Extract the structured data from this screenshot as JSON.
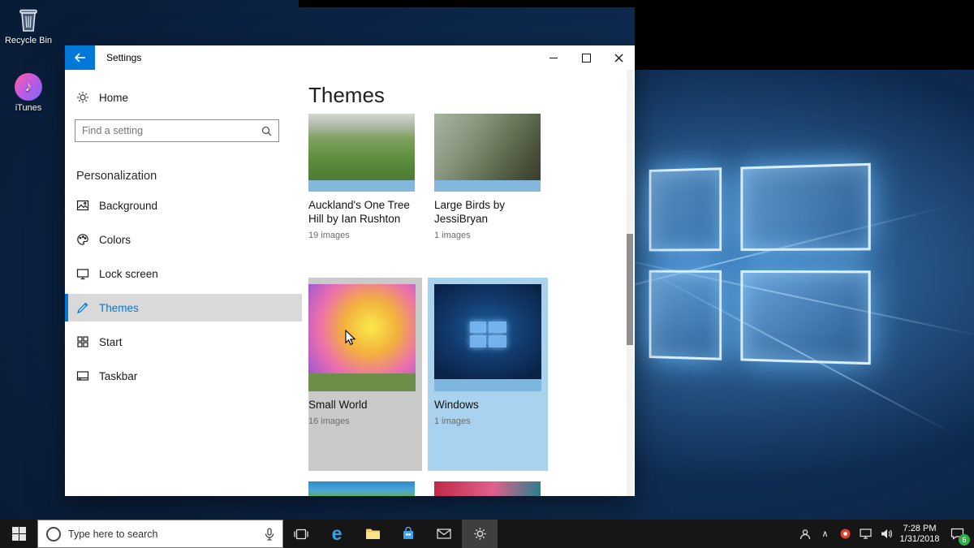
{
  "accent": "#0078d7",
  "desktop": {
    "icons": [
      {
        "label": "Recycle Bin"
      },
      {
        "label": "iTunes"
      }
    ]
  },
  "settings_window": {
    "title": "Settings",
    "sidebar": {
      "home": "Home",
      "search_placeholder": "Find a setting",
      "section": "Personalization",
      "items": [
        {
          "label": "Background"
        },
        {
          "label": "Colors"
        },
        {
          "label": "Lock screen"
        },
        {
          "label": "Themes"
        },
        {
          "label": "Start"
        },
        {
          "label": "Taskbar"
        }
      ]
    },
    "content": {
      "heading": "Themes",
      "cards": [
        {
          "title": "Auckland's One Tree Hill by Ian Rushton",
          "count": "19 images"
        },
        {
          "title": "Large Birds by JessiBryan",
          "count": "1 images"
        },
        {
          "title": "Small World",
          "count": "16 images"
        },
        {
          "title": "Windows",
          "count": "1 images"
        }
      ]
    }
  },
  "taskbar": {
    "search_text": "Type here to search",
    "clock": {
      "time": "7:28 PM",
      "date": "1/31/2018"
    },
    "notification_count": "6"
  },
  "icons": {
    "edge_glyph": "e",
    "chevron_up": "∧",
    "music_note": "♪"
  }
}
